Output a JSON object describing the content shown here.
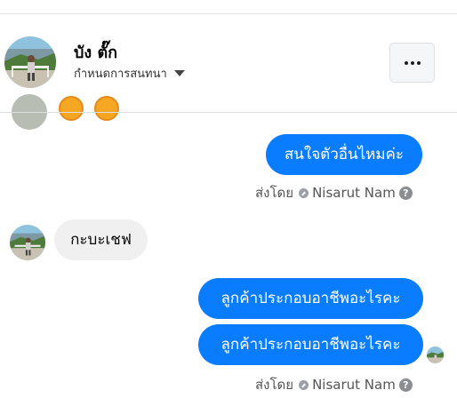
{
  "header": {
    "contact_name": "บัง ตั๊ก",
    "conversation_settings_label": "กำหนดการสนทนา",
    "more_button_label": "•••"
  },
  "messages": [
    {
      "direction": "outgoing",
      "text": "สนใจตัวอื่นไหมค่ะ"
    },
    {
      "direction": "incoming",
      "text": "กะบะเชฟ"
    },
    {
      "direction": "outgoing",
      "text": "ลูกค้าประกอบอาชีพอะไรคะ"
    },
    {
      "direction": "outgoing",
      "text": "ลูกค้าประกอบอาชีพอะไรคะ"
    }
  ],
  "sent_by": [
    {
      "label": "ส่งโดย",
      "name": "Nisarut Nam",
      "help": "?"
    },
    {
      "label": "ส่งโดย",
      "name": "Nisarut Nam",
      "help": "?"
    }
  ],
  "colors": {
    "outgoing_bubble": "#0a7cff",
    "incoming_bubble": "#f0f0f0",
    "divider": "#dddfe2"
  },
  "icons": {
    "more": "more-options-icon",
    "dropdown": "caret-down-icon",
    "page_admin": "page-admin-icon",
    "help": "help-icon",
    "seen": "seen-avatar-icon"
  }
}
